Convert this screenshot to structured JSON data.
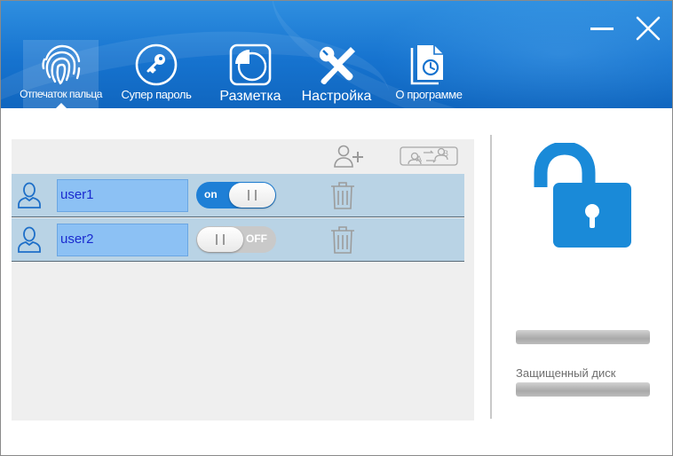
{
  "nav": {
    "items": [
      {
        "label": "Отпечаток пальца",
        "icon": "fingerprint-icon",
        "active": true
      },
      {
        "label": "Супер пароль",
        "icon": "key-icon",
        "active": false
      },
      {
        "label": "Разметка",
        "icon": "partition-pie-icon",
        "active": false
      },
      {
        "label": "Настройка",
        "icon": "tools-icon",
        "active": false
      },
      {
        "label": "О программе",
        "icon": "about-document-icon",
        "active": false
      }
    ]
  },
  "window_controls": {
    "minimize": "minimize-icon",
    "close": "close-icon"
  },
  "toolbar": {
    "add_user_icon": "add-user-icon",
    "swap_users_icon": "swap-users-icon"
  },
  "users": [
    {
      "name": "user1",
      "toggle_state": "on",
      "toggle_label": "on"
    },
    {
      "name": "user2",
      "toggle_state": "off",
      "toggle_label": "OFF"
    }
  ],
  "right_panel": {
    "lock_icon": "unlocked-padlock-icon",
    "protected_disk_label": "Защищенный диск"
  },
  "colors": {
    "header": "#1673cf",
    "accent": "#1e88d8",
    "row_background": "#b9d3e5",
    "name_field": "#8cc1f4",
    "name_text": "#1a2bcf"
  }
}
